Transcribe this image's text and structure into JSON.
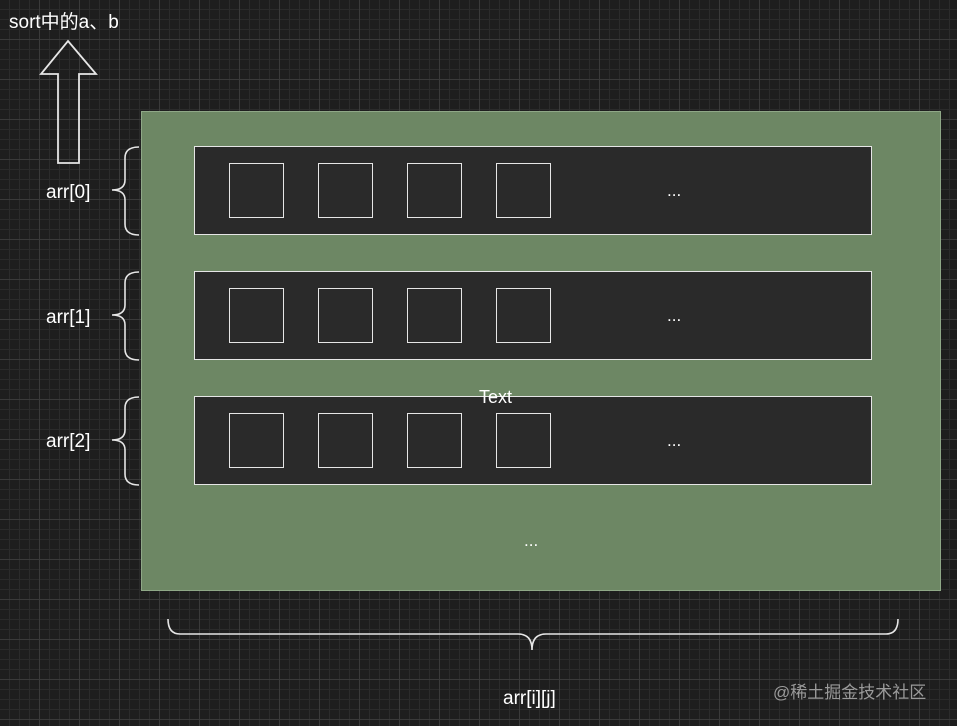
{
  "top_label": "sort中的a、b",
  "row_labels": [
    "arr[0]",
    "arr[1]",
    "arr[2]"
  ],
  "row_ellipsis": "...",
  "center_text": "Text",
  "matrix_ellipsis": "...",
  "bottom_label": "arr[i][j]",
  "watermark": "@稀土掘金技术社区",
  "colors": {
    "background": "#1e1e1e",
    "matrix_fill": "#6d8764",
    "row_fill": "#2a2a2a",
    "stroke": "#e6e6e6"
  }
}
